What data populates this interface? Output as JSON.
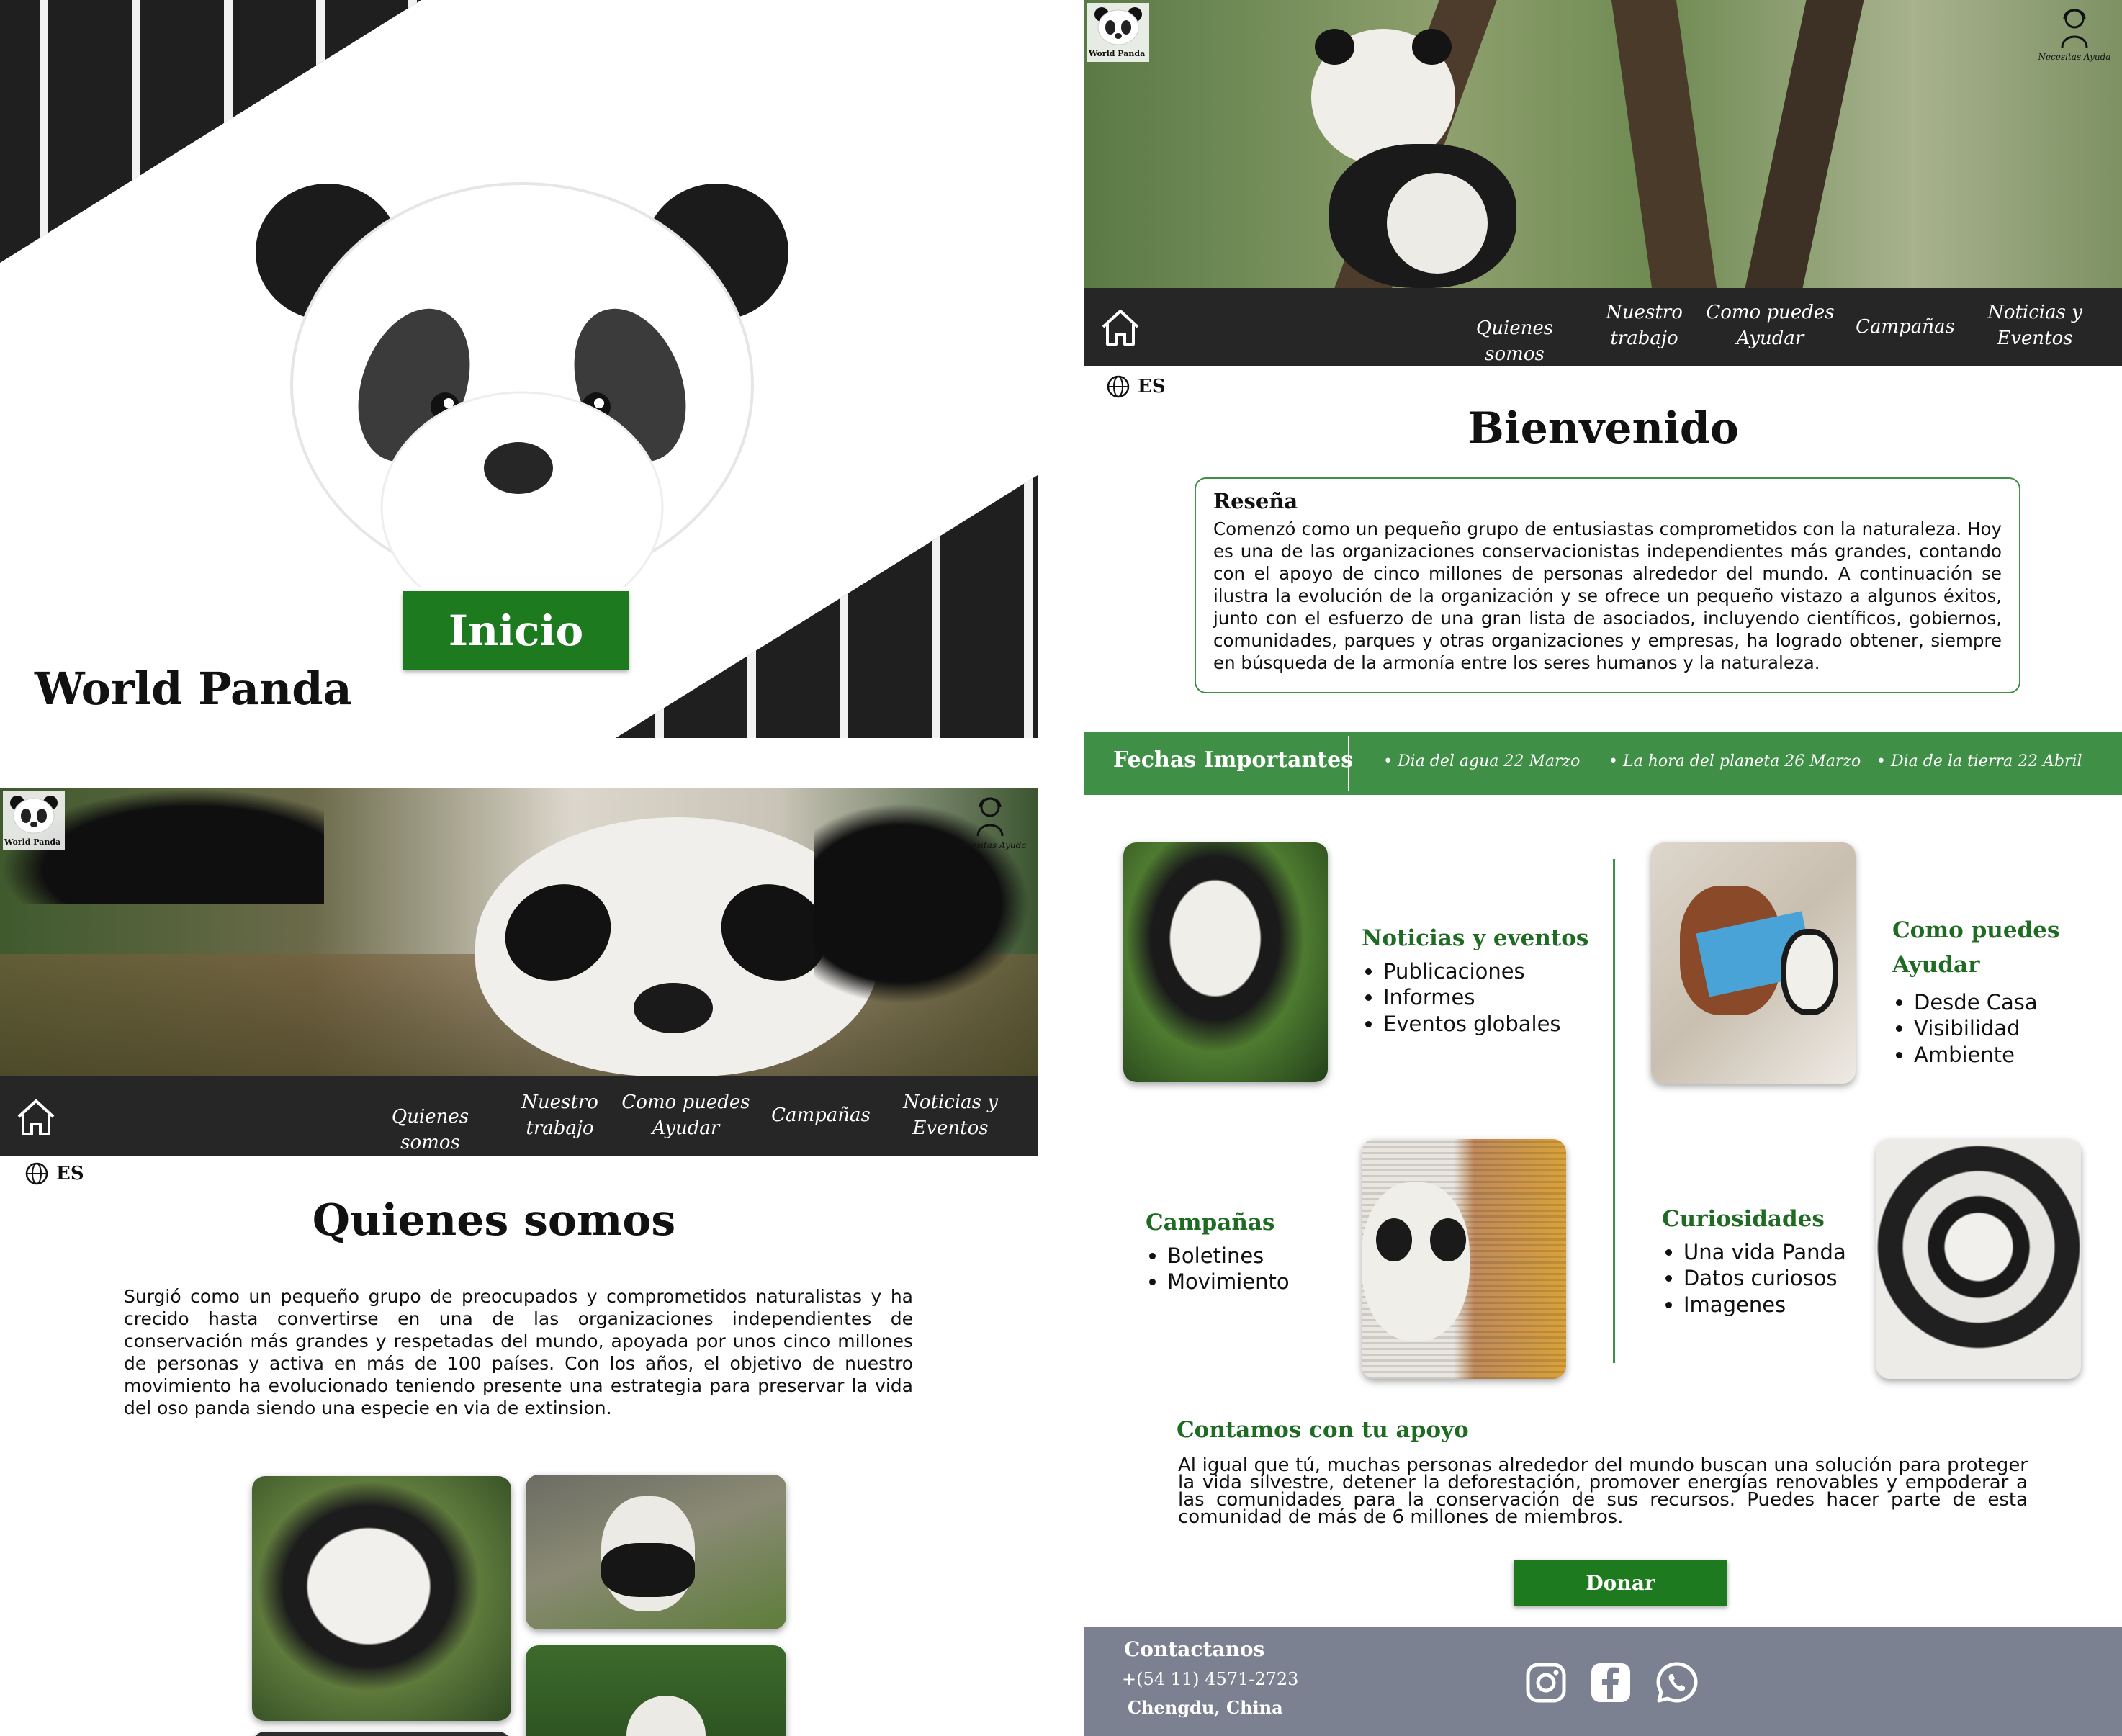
{
  "splash": {
    "title": "World Panda",
    "button": "Inicio"
  },
  "header": {
    "logo_label": "World Panda",
    "help_label": "Necesitas Ayuda",
    "nav": [
      "Quienes somos",
      "Nuestro trabajo",
      "Como puedes Ayudar",
      "Campañas",
      "Noticias y Eventos"
    ],
    "nav_lines": {
      "quienes": [
        "Quienes somos"
      ],
      "nuestro": [
        "Nuestro",
        "trabajo"
      ],
      "como": [
        "Como puedes",
        "Ayudar"
      ],
      "campanas": [
        "Campañas"
      ],
      "noticias": [
        "Noticias y",
        "Eventos"
      ]
    },
    "lang": "ES"
  },
  "about": {
    "title": "Quienes somos",
    "text": "Surgió como un pequeño grupo de preocupados y comprometidos naturalistas y ha crecido hasta convertirse en una de las organizaciones independientes de conservación más grandes y respetadas del mundo, apoyada por unos cinco millones de personas y activa en más de 100 países. Con los años, el objetivo de nuestro movimiento ha evolucionado teniendo presente una estrategia para preservar la vida del oso panda siendo una especie en via de extinsion."
  },
  "home": {
    "title": "Bienvenido",
    "review_title": "Reseña",
    "review_text": "Comenzó como un pequeño grupo de entusiastas comprometidos con la naturaleza. Hoy es una de las organizaciones conservacionistas independientes más grandes, contando con el apoyo de cinco millones de personas alrededor del mundo. A continuación se ilustra la evolución de la organización y se ofrece un pequeño vistazo a algunos éxitos, junto con el esfuerzo de una gran lista de asociados, incluyendo científicos, gobiernos, comunidades, parques y otras organizaciones y empresas, ha logrado obtener, siempre en búsqueda de la armonía entre los seres humanos y la naturaleza.",
    "dates_title": "Fechas Importantes",
    "dates": [
      "Dia del agua 22 Marzo",
      "La hora del planeta 26 Marzo",
      "Dia de la tierra 22 Abril"
    ],
    "cards": {
      "noticias": {
        "title": "Noticias y eventos",
        "items": [
          "Publicaciones",
          "Informes",
          "Eventos globales"
        ]
      },
      "ayudar": {
        "title": "Como puedes Ayudar",
        "items": [
          "Desde Casa",
          "Visibilidad",
          "Ambiente"
        ]
      },
      "campanas": {
        "title": "Campañas",
        "items": [
          "Boletines",
          "Movimiento"
        ]
      },
      "curiosidades": {
        "title": "Curiosidades",
        "items": [
          "Una vida Panda",
          "Datos curiosos",
          "Imagenes"
        ]
      }
    },
    "support_title": "Contamos con tu apoyo",
    "support_text": "Al igual que tú, muchas personas alrededor del mundo buscan una solución para proteger la vida silvestre, detener la deforestación, promover energías renovables y empoderar a las comunidades para la conservación de sus recursos. Puedes hacer parte de esta comunidad de más de 6 millones de miembros.",
    "donate": "Donar"
  },
  "footer": {
    "contact_title": "Contactanos",
    "phone": "+(54 11) 4571-2723",
    "city": "Chengdu, China"
  },
  "colors": {
    "accent": "#1f7a1f",
    "dates_bar": "#3f8f46",
    "nav": "#262626",
    "footer": "#7b8190"
  }
}
